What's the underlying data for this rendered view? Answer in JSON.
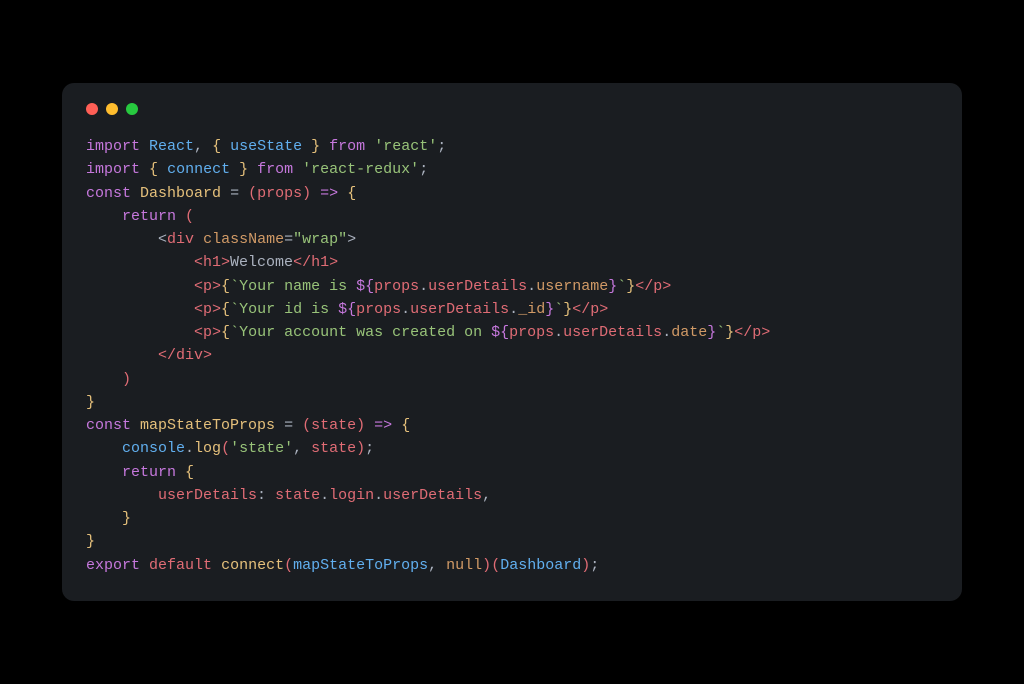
{
  "colors": {
    "background": "#000000",
    "window": "#1a1d21",
    "red": "#ff5f56",
    "yellow": "#ffbd2e",
    "green": "#27c93f",
    "keyword": "#c678dd",
    "class": "#61afef",
    "function": "#e5c07b",
    "string": "#98c379",
    "default_text": "#abb2bf",
    "variable": "#e06c75",
    "property": "#d19a66"
  },
  "code": {
    "l1": {
      "import": "import",
      "react": "React",
      "comma": ",",
      "lbrace": "{",
      "usestate": "useState",
      "rbrace": "}",
      "from": "from",
      "module": "'react'",
      "semi": ";"
    },
    "l2": {
      "import": "import",
      "lbrace": "{",
      "connect": "connect",
      "rbrace": "}",
      "from": "from",
      "module": "'react-redux'",
      "semi": ";"
    },
    "l3": {
      "const": "const",
      "name": "Dashboard",
      "eq": "=",
      "lparen": "(",
      "props": "props",
      "rparen": ")",
      "arrow": "=>",
      "lbrace": "{"
    },
    "l4": {
      "return": "return",
      "lparen": "("
    },
    "l5": {
      "lt": "<",
      "div": "div",
      "attr": "className",
      "eq": "=",
      "val": "\"wrap\"",
      "gt": ">"
    },
    "l6": {
      "open": "<h1>",
      "text": "Welcome",
      "close": "</h1>"
    },
    "l7": {
      "popen": "<p>",
      "lbrace": "{",
      "str1": "`Your name is ",
      "dollar": "${",
      "props": "props",
      "dot1": ".",
      "ud": "userDetails",
      "dot2": ".",
      "field": "username",
      "close": "}",
      "str2": "`",
      "rbrace": "}",
      "pclose": "</p>"
    },
    "l8": {
      "popen": "<p>",
      "lbrace": "{",
      "str1": "`Your id is ",
      "dollar": "${",
      "props": "props",
      "dot1": ".",
      "ud": "userDetails",
      "dot2": ".",
      "field": "_id",
      "close": "}",
      "str2": "`",
      "rbrace": "}",
      "pclose": "</p>"
    },
    "l9": {
      "popen": "<p>",
      "lbrace": "{",
      "str1": "`Your account was created on ",
      "dollar": "${",
      "props": "props",
      "dot1": ".",
      "ud": "userDetails",
      "dot2": ".",
      "field": "date",
      "close": "}",
      "str2": "`",
      "rbrace": "}",
      "pclose": "</p>"
    },
    "l10": {
      "close": "</div>"
    },
    "l11": {
      "rparen": ")"
    },
    "l12": {
      "rbrace": "}"
    },
    "l13": {
      "const": "const",
      "name": "mapStateToProps",
      "eq": "=",
      "lparen": "(",
      "state": "state",
      "rparen": ")",
      "arrow": "=>",
      "lbrace": "{"
    },
    "l14": {
      "console": "console",
      "dot": ".",
      "log": "log",
      "lparen": "(",
      "str": "'state'",
      "comma": ",",
      "state": "state",
      "rparen": ")",
      "semi": ";"
    },
    "l15": {
      "return": "return",
      "lbrace": "{"
    },
    "l16": {
      "key": "userDetails",
      "colon": ":",
      "state": "state",
      "dot1": ".",
      "login": "login",
      "dot2": ".",
      "ud": "userDetails",
      "comma": ","
    },
    "l17": {
      "rbrace": "}"
    },
    "l18": {
      "rbrace": "}"
    },
    "l19": {
      "export": "export",
      "default": "default",
      "connect": "connect",
      "lparen": "(",
      "mstp": "mapStateToProps",
      "comma": ",",
      "null": "null",
      "rparen": ")",
      "lparen2": "(",
      "dash": "Dashboard",
      "rparen2": ")",
      "semi": ";"
    }
  }
}
